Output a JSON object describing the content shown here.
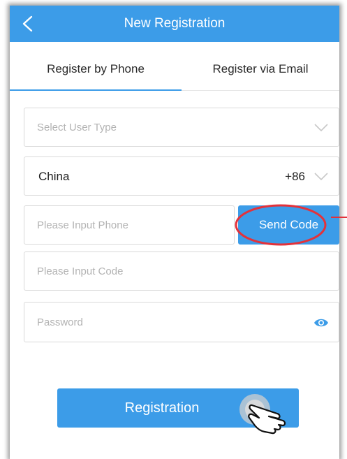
{
  "header": {
    "title": "New Registration",
    "back_icon": "chevron-left-icon"
  },
  "tabs": [
    {
      "label": "Register by Phone",
      "active": true
    },
    {
      "label": "Register via Email",
      "active": false
    }
  ],
  "form": {
    "user_type": {
      "placeholder": "Select User Type",
      "value": ""
    },
    "country": {
      "value": "China",
      "dial_code": "+86"
    },
    "phone": {
      "placeholder": "Please Input Phone",
      "value": ""
    },
    "send_code_label": "Send Code",
    "code": {
      "placeholder": "Please Input Code",
      "value": ""
    },
    "password": {
      "placeholder": "Password",
      "value": "",
      "toggle_icon": "eye-icon"
    }
  },
  "submit_label": "Registration",
  "colors": {
    "accent": "#3c9ce8",
    "annotation": "#e3323b",
    "placeholder": "#b3b3b3",
    "border": "#d9d9d9"
  },
  "annotations": {
    "highlight": "send-code-circle",
    "cursor": "hand-pointer-icon"
  }
}
